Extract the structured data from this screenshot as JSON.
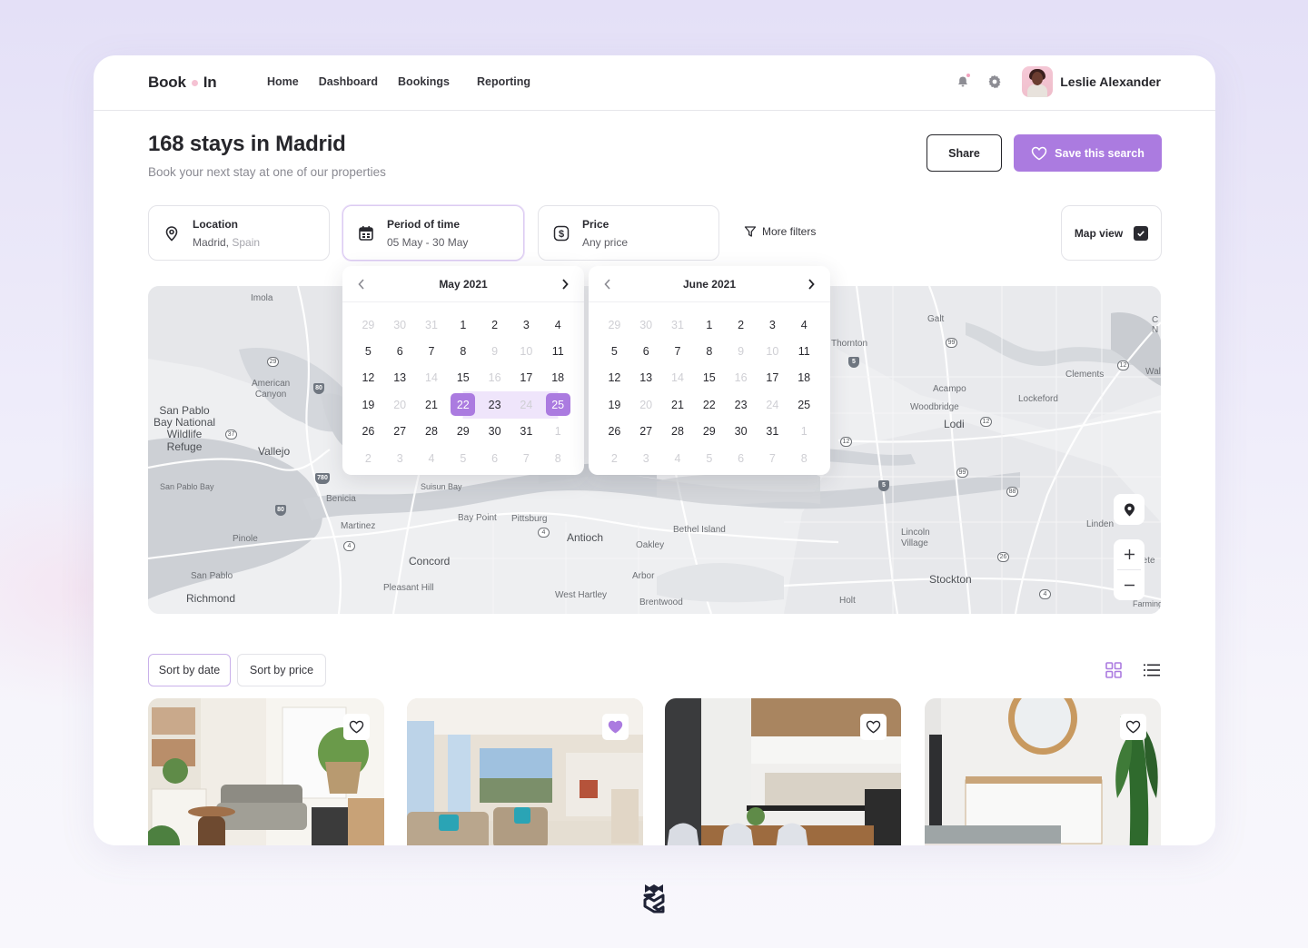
{
  "app": {
    "logo_left": "Book",
    "logo_right": "In",
    "nav": [
      {
        "label": "Home"
      },
      {
        "label": "Dashboard"
      },
      {
        "label": "Bookings"
      },
      {
        "label": "Reporting"
      }
    ],
    "icons": {
      "notifications": "bell-icon",
      "settings": "gear-icon"
    },
    "user": {
      "name": "Leslie Alexander"
    }
  },
  "page": {
    "title": "168 stays in Madrid",
    "subtitle": "Book your next stay at one of our properties",
    "share_label": "Share",
    "save_label": "Save this search"
  },
  "filters": {
    "location": {
      "label": "Location",
      "value_city": "Madrid,",
      "value_country": "Spain",
      "icon": "map-pin-icon"
    },
    "period": {
      "label": "Period of time",
      "value": "05 May - 30 May",
      "icon": "calendar-icon"
    },
    "price": {
      "label": "Price",
      "value": "Any price",
      "icon": "dollar-icon"
    },
    "more_filters_label": "More filters",
    "map_view_label": "Map view",
    "map_view_checked": true
  },
  "calendars": [
    {
      "title": "May 2021",
      "weeks": [
        [
          {
            "d": "29",
            "s": "dim"
          },
          {
            "d": "30",
            "s": "dim"
          },
          {
            "d": "31",
            "s": "dim"
          },
          {
            "d": "1",
            "s": ""
          },
          {
            "d": "2",
            "s": ""
          },
          {
            "d": "3",
            "s": ""
          },
          {
            "d": "4",
            "s": ""
          }
        ],
        [
          {
            "d": "5",
            "s": ""
          },
          {
            "d": "6",
            "s": ""
          },
          {
            "d": "7",
            "s": ""
          },
          {
            "d": "8",
            "s": ""
          },
          {
            "d": "9",
            "s": "dim"
          },
          {
            "d": "10",
            "s": "dim"
          },
          {
            "d": "11",
            "s": ""
          }
        ],
        [
          {
            "d": "12",
            "s": ""
          },
          {
            "d": "13",
            "s": ""
          },
          {
            "d": "14",
            "s": "dim"
          },
          {
            "d": "15",
            "s": ""
          },
          {
            "d": "16",
            "s": "dim"
          },
          {
            "d": "17",
            "s": ""
          },
          {
            "d": "18",
            "s": ""
          }
        ],
        [
          {
            "d": "19",
            "s": ""
          },
          {
            "d": "20",
            "s": "dim"
          },
          {
            "d": "21",
            "s": ""
          },
          {
            "d": "22",
            "s": "start"
          },
          {
            "d": "23",
            "s": "range"
          },
          {
            "d": "24",
            "s": "range-dim"
          },
          {
            "d": "25",
            "s": "end"
          }
        ],
        [
          {
            "d": "26",
            "s": ""
          },
          {
            "d": "27",
            "s": ""
          },
          {
            "d": "28",
            "s": ""
          },
          {
            "d": "29",
            "s": ""
          },
          {
            "d": "30",
            "s": ""
          },
          {
            "d": "31",
            "s": ""
          },
          {
            "d": "1",
            "s": "dim"
          }
        ],
        [
          {
            "d": "2",
            "s": "dim"
          },
          {
            "d": "3",
            "s": "dim"
          },
          {
            "d": "4",
            "s": "dim"
          },
          {
            "d": "5",
            "s": "dim"
          },
          {
            "d": "6",
            "s": "dim"
          },
          {
            "d": "7",
            "s": "dim"
          },
          {
            "d": "8",
            "s": "dim"
          }
        ]
      ]
    },
    {
      "title": "June 2021",
      "weeks": [
        [
          {
            "d": "29",
            "s": "dim"
          },
          {
            "d": "30",
            "s": "dim"
          },
          {
            "d": "31",
            "s": "dim"
          },
          {
            "d": "1",
            "s": ""
          },
          {
            "d": "2",
            "s": ""
          },
          {
            "d": "3",
            "s": ""
          },
          {
            "d": "4",
            "s": ""
          }
        ],
        [
          {
            "d": "5",
            "s": ""
          },
          {
            "d": "6",
            "s": ""
          },
          {
            "d": "7",
            "s": ""
          },
          {
            "d": "8",
            "s": ""
          },
          {
            "d": "9",
            "s": "dim"
          },
          {
            "d": "10",
            "s": "dim"
          },
          {
            "d": "11",
            "s": ""
          }
        ],
        [
          {
            "d": "12",
            "s": ""
          },
          {
            "d": "13",
            "s": ""
          },
          {
            "d": "14",
            "s": "dim"
          },
          {
            "d": "15",
            "s": ""
          },
          {
            "d": "16",
            "s": "dim"
          },
          {
            "d": "17",
            "s": ""
          },
          {
            "d": "18",
            "s": ""
          }
        ],
        [
          {
            "d": "19",
            "s": ""
          },
          {
            "d": "20",
            "s": "dim"
          },
          {
            "d": "21",
            "s": ""
          },
          {
            "d": "22",
            "s": ""
          },
          {
            "d": "23",
            "s": ""
          },
          {
            "d": "24",
            "s": "dim"
          },
          {
            "d": "25",
            "s": ""
          }
        ],
        [
          {
            "d": "26",
            "s": ""
          },
          {
            "d": "27",
            "s": ""
          },
          {
            "d": "28",
            "s": ""
          },
          {
            "d": "29",
            "s": ""
          },
          {
            "d": "30",
            "s": ""
          },
          {
            "d": "31",
            "s": ""
          },
          {
            "d": "1",
            "s": "dim"
          }
        ],
        [
          {
            "d": "2",
            "s": "dim"
          },
          {
            "d": "3",
            "s": "dim"
          },
          {
            "d": "4",
            "s": "dim"
          },
          {
            "d": "5",
            "s": "dim"
          },
          {
            "d": "6",
            "s": "dim"
          },
          {
            "d": "7",
            "s": "dim"
          },
          {
            "d": "8",
            "s": "dim"
          }
        ]
      ]
    }
  ],
  "map": {
    "labels": [
      {
        "t": "Imola",
        "c": "small"
      },
      {
        "t": "American\nCanyon",
        "c": "small"
      },
      {
        "t": "San Pablo\nBay National\nWildlife\nRefuge",
        "c": "big"
      },
      {
        "t": "Vallejo",
        "c": "big"
      },
      {
        "t": "San Pablo Bay",
        "c": "small"
      },
      {
        "t": "Benicia",
        "c": "small"
      },
      {
        "t": "Suisun Bay",
        "c": "small"
      },
      {
        "t": "Martinez",
        "c": "small"
      },
      {
        "t": "Pinole",
        "c": "small"
      },
      {
        "t": "Bay Point",
        "c": "small"
      },
      {
        "t": "Pittsburg",
        "c": "small"
      },
      {
        "t": "Antioch",
        "c": "big"
      },
      {
        "t": "Concord",
        "c": "big"
      },
      {
        "t": "Pleasant Hill",
        "c": "small"
      },
      {
        "t": "San Pablo",
        "c": "small"
      },
      {
        "t": "Richmond",
        "c": "big"
      },
      {
        "t": "West Hartley",
        "c": "small"
      },
      {
        "t": "Oakley",
        "c": "small"
      },
      {
        "t": "Bethel Island",
        "c": "small"
      },
      {
        "t": "Arbor",
        "c": "small"
      },
      {
        "t": "Brentwood",
        "c": "small"
      },
      {
        "t": "Galt",
        "c": "small"
      },
      {
        "t": "Thornton",
        "c": "small"
      },
      {
        "t": "Acampo",
        "c": "small"
      },
      {
        "t": "Woodbridge",
        "c": "small"
      },
      {
        "t": "Lodi",
        "c": "big"
      },
      {
        "t": "Lockeford",
        "c": "small"
      },
      {
        "t": "Clements",
        "c": "small"
      },
      {
        "t": "Linden",
        "c": "small"
      },
      {
        "t": "Lincoln\nVillage",
        "c": "small"
      },
      {
        "t": "Stockton",
        "c": "big"
      },
      {
        "t": "Holt",
        "c": "small"
      },
      {
        "t": "Pete",
        "c": "small"
      },
      {
        "t": "Farmingto",
        "c": "small"
      },
      {
        "t": "Wall",
        "c": "small"
      },
      {
        "t": "C\nN",
        "c": "small"
      }
    ],
    "route_shields": [
      "29",
      "37",
      "4",
      "4",
      "99",
      "12",
      "12",
      "12",
      "99",
      "88",
      "26",
      "4"
    ],
    "interstate_shields": [
      "80",
      "780",
      "80",
      "5",
      "5"
    ],
    "controls": {
      "locate": "map-pin-icon",
      "zoom_in": "+",
      "zoom_out": "−"
    }
  },
  "sort": {
    "by_date_label": "Sort by date",
    "by_price_label": "Sort by price",
    "active": "date"
  },
  "view": {
    "grid": "grid-view-icon",
    "list": "list-view-icon",
    "active": "grid"
  },
  "listings": [
    {
      "scene": "living room with plants",
      "favorited": false
    },
    {
      "scene": "bright living room with windows",
      "favorited": true
    },
    {
      "scene": "modern kitchen with dining table",
      "favorited": false
    },
    {
      "scene": "bedroom with round mirror and plant",
      "favorited": false
    }
  ],
  "colors": {
    "accent": "#ab7be0",
    "accent_light": "#efe5fb",
    "text_primary": "#26262b",
    "text_muted": "#8a8a92",
    "logo_dot": "#f5c2d3"
  }
}
